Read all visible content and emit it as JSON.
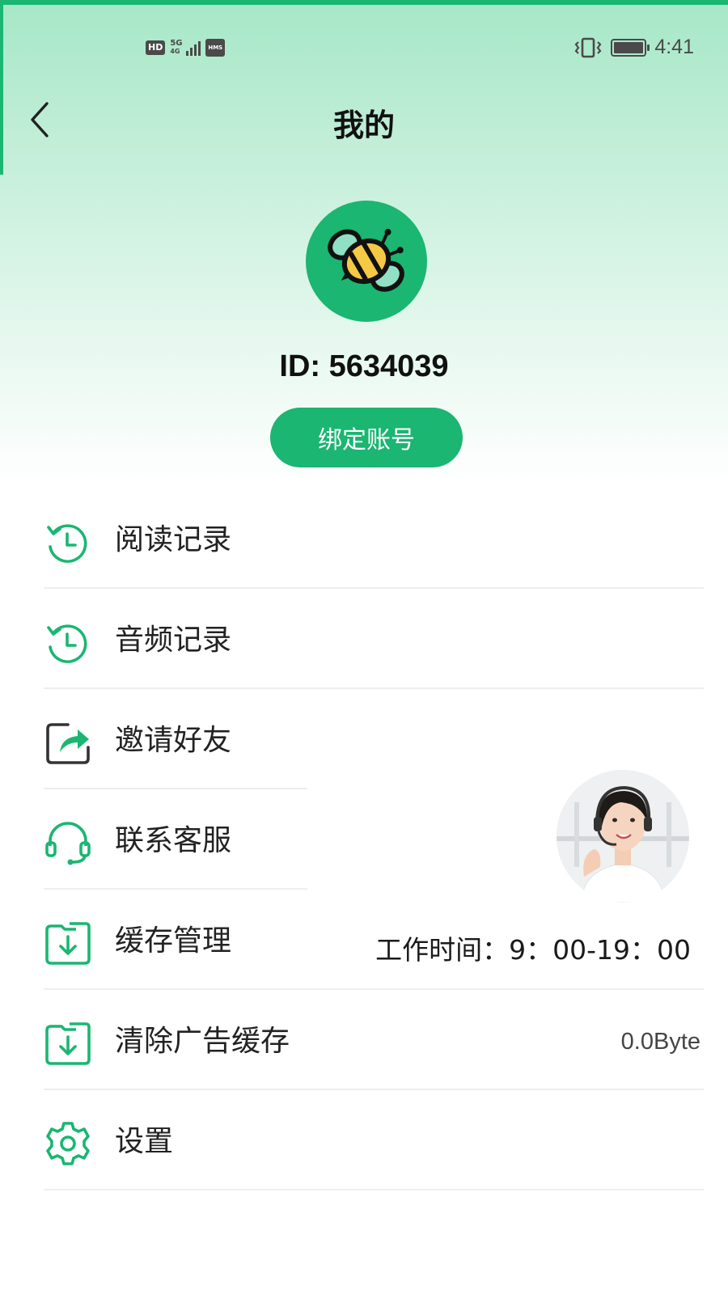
{
  "status_bar": {
    "network_badge": "HD",
    "network_type": "5G",
    "network_sub": "4G",
    "hms_badge": "HMS",
    "time": "4:41"
  },
  "header": {
    "title": "我的"
  },
  "profile": {
    "id_text": "ID: 5634039",
    "bind_button": "绑定账号"
  },
  "menu": {
    "items": [
      {
        "label": "阅读记录",
        "icon": "history-icon"
      },
      {
        "label": "音频记录",
        "icon": "history-icon"
      },
      {
        "label": "邀请好友",
        "icon": "share-icon"
      },
      {
        "label": "联系客服",
        "icon": "headset-icon"
      },
      {
        "label": "缓存管理",
        "icon": "download-folder-icon"
      },
      {
        "label": "清除广告缓存",
        "icon": "download-folder-icon",
        "value": "0.0Byte"
      },
      {
        "label": "设置",
        "icon": "gear-icon"
      }
    ]
  },
  "customer_service": {
    "work_time": "工作时间：9：00-19：00"
  },
  "colors": {
    "accent": "#1ab672",
    "header_gradient_top": "#a6e7c7",
    "text": "#222222"
  }
}
